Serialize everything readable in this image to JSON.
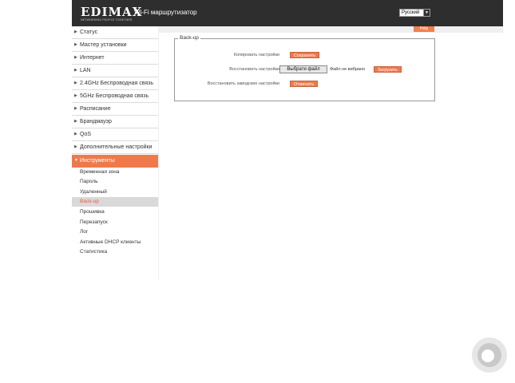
{
  "header": {
    "logo": "EDIMAX",
    "logo_tagline": "NETWORKING PEOPLE TOGETHER",
    "title": "Wi-Fi маршрутизатор",
    "language": "Русский",
    "help": "Help"
  },
  "sidebar": {
    "items": [
      {
        "label": "Статус"
      },
      {
        "label": "Мастер установки"
      },
      {
        "label": "Интернет"
      },
      {
        "label": "LAN"
      },
      {
        "label": "2.4GHz Беспроводная связь"
      },
      {
        "label": "5GHz Беспроводная связь"
      },
      {
        "label": "Расписание"
      },
      {
        "label": "Брандмауэр"
      },
      {
        "label": "QoS"
      },
      {
        "label": "Дополнительные настройки"
      },
      {
        "label": "Инструменты"
      }
    ],
    "subitems": [
      {
        "label": "Временная зона"
      },
      {
        "label": "Пароль"
      },
      {
        "label": "Удаленный"
      },
      {
        "label": "Back-up"
      },
      {
        "label": "Прошивка"
      },
      {
        "label": "Перезапуск"
      },
      {
        "label": "Лог"
      },
      {
        "label": "Активные DHCP клиенты"
      },
      {
        "label": "Статистика"
      }
    ]
  },
  "backup": {
    "legend": "Back-up",
    "save_label": "Копировать настройки",
    "save_button": "Сохранить",
    "restore_label": "Восстановить настройки",
    "choose_file_button": "Выбрати файл",
    "no_file_text": "Файл не вибрано",
    "upload_button": "Загрузить",
    "factory_label": "Восстановить заводские настройки",
    "factory_button": "Отменить"
  },
  "colors": {
    "accent": "#ee7a4c",
    "header_bg": "#2e2e2e"
  }
}
